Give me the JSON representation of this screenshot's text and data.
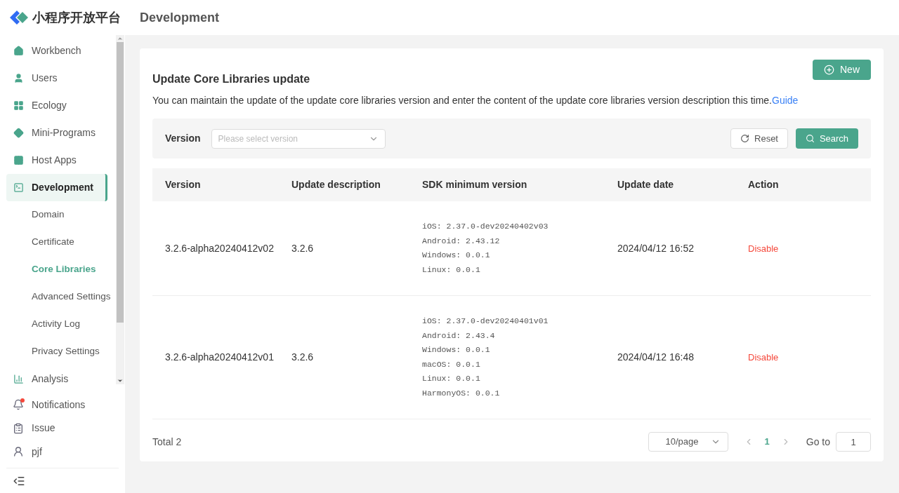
{
  "logo": {
    "text": "小程序开放平台"
  },
  "sidebar": {
    "items": [
      {
        "label": "Workbench",
        "selected": false
      },
      {
        "label": "Users",
        "selected": false
      },
      {
        "label": "Ecology",
        "selected": false
      },
      {
        "label": "Mini-Programs",
        "selected": false
      },
      {
        "label": "Host Apps",
        "selected": false
      },
      {
        "label": "Development",
        "selected": true,
        "children": [
          {
            "label": "Domain",
            "selected": false
          },
          {
            "label": "Certificate",
            "selected": false
          },
          {
            "label": "Core Libraries",
            "selected": true
          },
          {
            "label": "Advanced Settings",
            "selected": false
          },
          {
            "label": "Activity Log",
            "selected": false
          },
          {
            "label": "Privacy Settings",
            "selected": false
          }
        ]
      },
      {
        "label": "Analysis",
        "selected": false
      }
    ],
    "footer": [
      {
        "label": "Notifications",
        "unread": true
      },
      {
        "label": "Issue",
        "unread": false
      },
      {
        "label": "pjf",
        "unread": false
      }
    ]
  },
  "header": {
    "title": "Development"
  },
  "card": {
    "title": "Update Core Libraries update",
    "description": "You can maintain the update of the update core libraries version and enter the content of the update core libraries version description this time.",
    "guide_link": "Guide",
    "new_button": "New"
  },
  "filter": {
    "label": "Version",
    "placeholder": "Please select version",
    "reset_button": "Reset",
    "search_button": "Search"
  },
  "table": {
    "columns": [
      "Version",
      "Update description",
      "SDK minimum version",
      "Update date",
      "Action"
    ],
    "rows": [
      {
        "version": "3.2.6-alpha20240412v02",
        "description": "3.2.6",
        "sdk": [
          "iOS: 2.37.0-dev20240402v03",
          "Android: 2.43.12",
          "Windows: 0.0.1",
          "Linux: 0.0.1"
        ],
        "date": "2024/04/12 16:52",
        "action": "Disable"
      },
      {
        "version": "3.2.6-alpha20240412v01",
        "description": "3.2.6",
        "sdk": [
          "iOS: 2.37.0-dev20240401v01",
          "Android: 2.43.4",
          "Windows: 0.0.1",
          "macOS: 0.0.1",
          "Linux: 0.0.1",
          "HarmonyOS: 0.0.1"
        ],
        "date": "2024/04/12 16:48",
        "action": "Disable"
      }
    ]
  },
  "pagination": {
    "total": "Total 2",
    "page_size": "10/page",
    "pages": [
      {
        "label": "1",
        "selected": true
      }
    ],
    "goto_label": "Go to",
    "goto_value": "1"
  }
}
